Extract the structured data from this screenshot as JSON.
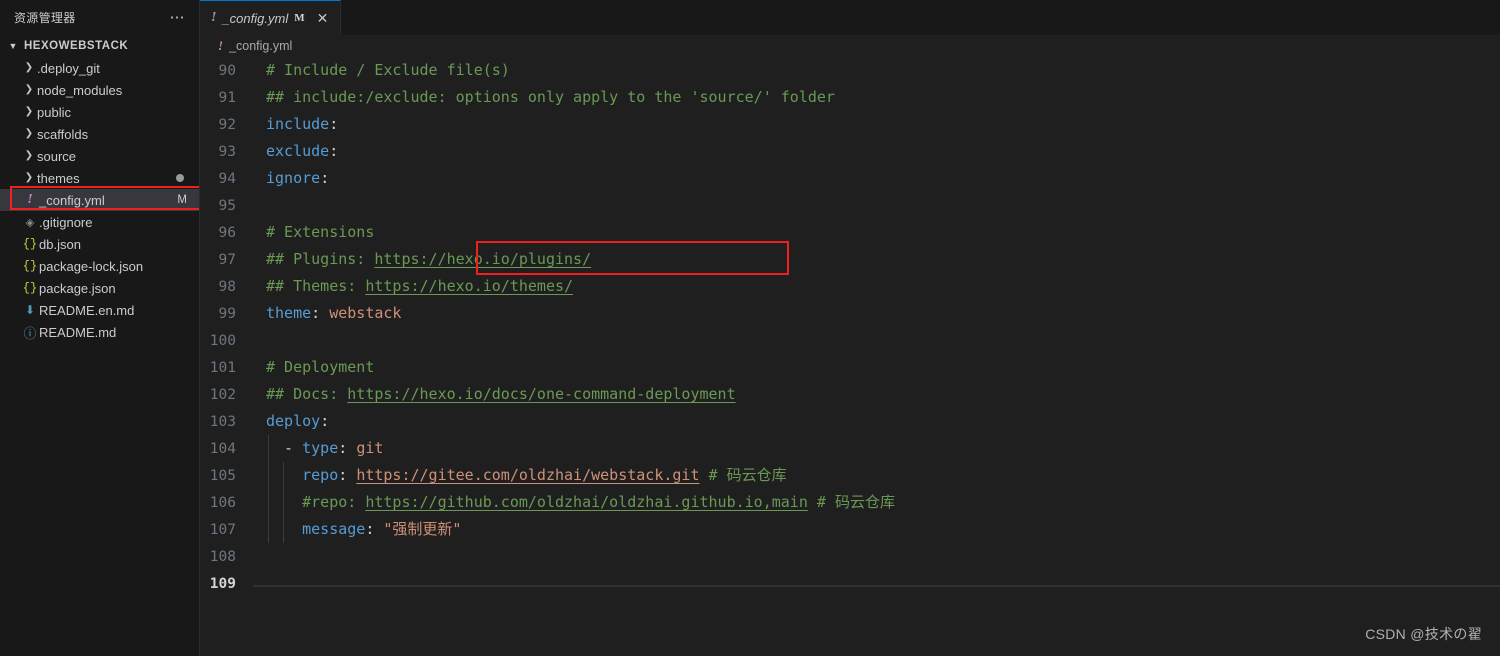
{
  "sidebar": {
    "title": "资源管理器",
    "more_label": "⋯",
    "root": {
      "label": "HEXOWEBSTACK",
      "chevron": "chevron-down"
    },
    "items": [
      {
        "label": ".deploy_git",
        "type": "folder",
        "icon": "chevron-right-icon",
        "badge": ""
      },
      {
        "label": "node_modules",
        "type": "folder",
        "icon": "chevron-right-icon",
        "badge": ""
      },
      {
        "label": "public",
        "type": "folder",
        "icon": "chevron-right-icon",
        "badge": ""
      },
      {
        "label": "scaffolds",
        "type": "folder",
        "icon": "chevron-right-icon",
        "badge": ""
      },
      {
        "label": "source",
        "type": "folder",
        "icon": "chevron-right-icon",
        "badge": ""
      },
      {
        "label": "themes",
        "type": "folder",
        "icon": "chevron-right-icon",
        "badge": "dot"
      },
      {
        "label": "_config.yml",
        "type": "file",
        "icon": "yml-icon",
        "badge": "M",
        "selected": true,
        "annotated": true
      },
      {
        "label": ".gitignore",
        "type": "file",
        "icon": "git-icon",
        "badge": ""
      },
      {
        "label": "db.json",
        "type": "file",
        "icon": "json-icon",
        "badge": ""
      },
      {
        "label": "package-lock.json",
        "type": "file",
        "icon": "json-icon",
        "badge": ""
      },
      {
        "label": "package.json",
        "type": "file",
        "icon": "json-icon",
        "badge": ""
      },
      {
        "label": "README.en.md",
        "type": "file",
        "icon": "markdown-download-icon",
        "badge": ""
      },
      {
        "label": "README.md",
        "type": "file",
        "icon": "markdown-info-icon",
        "badge": ""
      }
    ]
  },
  "tab": {
    "icon": "yml-icon",
    "name": "_config.yml",
    "modified_badge": "M",
    "close": "✕"
  },
  "breadcrumb": {
    "icon": "yml-icon",
    "label": "_config.yml"
  },
  "editor": {
    "first_line": 90,
    "current_line": 109,
    "lines": [
      {
        "n": 90,
        "tokens": [
          {
            "t": "# Include / Exclude file(s)",
            "c": "cm"
          }
        ]
      },
      {
        "n": 91,
        "tokens": [
          {
            "t": "## include:/exclude: options only apply to the 'source/' folder",
            "c": "cm"
          }
        ]
      },
      {
        "n": 92,
        "tokens": [
          {
            "t": "include",
            "c": "key"
          },
          {
            "t": ":",
            "c": "pun"
          }
        ]
      },
      {
        "n": 93,
        "tokens": [
          {
            "t": "exclude",
            "c": "key"
          },
          {
            "t": ":",
            "c": "pun"
          }
        ]
      },
      {
        "n": 94,
        "tokens": [
          {
            "t": "ignore",
            "c": "key"
          },
          {
            "t": ":",
            "c": "pun"
          }
        ]
      },
      {
        "n": 95,
        "tokens": []
      },
      {
        "n": 96,
        "tokens": [
          {
            "t": "# Extensions",
            "c": "cm"
          }
        ]
      },
      {
        "n": 97,
        "tokens": [
          {
            "t": "## Plugins: ",
            "c": "cm"
          },
          {
            "t": "https://hexo.io/plugins/",
            "c": "lnk-green"
          }
        ]
      },
      {
        "n": 98,
        "tokens": [
          {
            "t": "## Themes: ",
            "c": "cm"
          },
          {
            "t": "https://hexo.io/themes/",
            "c": "lnk-green"
          }
        ]
      },
      {
        "n": 99,
        "tokens": [
          {
            "t": "theme",
            "c": "key"
          },
          {
            "t": ": ",
            "c": "pun"
          },
          {
            "t": "webstack",
            "c": "str"
          }
        ],
        "annotated": true
      },
      {
        "n": 100,
        "tokens": []
      },
      {
        "n": 101,
        "tokens": [
          {
            "t": "# Deployment",
            "c": "cm"
          }
        ]
      },
      {
        "n": 102,
        "tokens": [
          {
            "t": "## Docs: ",
            "c": "cm"
          },
          {
            "t": "https://hexo.io/docs/one-command-deployment",
            "c": "lnk-green"
          }
        ]
      },
      {
        "n": 103,
        "tokens": [
          {
            "t": "deploy",
            "c": "key"
          },
          {
            "t": ":",
            "c": "pun"
          }
        ]
      },
      {
        "n": 104,
        "tokens": [
          {
            "t": "  - ",
            "c": "dash"
          },
          {
            "t": "type",
            "c": "key"
          },
          {
            "t": ": ",
            "c": "pun"
          },
          {
            "t": "git",
            "c": "str"
          }
        ],
        "guides": 1
      },
      {
        "n": 105,
        "tokens": [
          {
            "t": "    ",
            "c": "pun"
          },
          {
            "t": "repo",
            "c": "key"
          },
          {
            "t": ": ",
            "c": "pun"
          },
          {
            "t": "https://gitee.com/oldzhai/webstack.git",
            "c": "lnk-orange"
          },
          {
            "t": " # 码云仓库",
            "c": "cm"
          }
        ],
        "guides": 2
      },
      {
        "n": 106,
        "tokens": [
          {
            "t": "    ",
            "c": "pun"
          },
          {
            "t": "#repo: ",
            "c": "cm"
          },
          {
            "t": "https://github.com/oldzhai/oldzhai.github.io,main",
            "c": "lnk-green"
          },
          {
            "t": " # 码云仓库",
            "c": "cm"
          }
        ],
        "guides": 2
      },
      {
        "n": 107,
        "tokens": [
          {
            "t": "    ",
            "c": "pun"
          },
          {
            "t": "message",
            "c": "key"
          },
          {
            "t": ": ",
            "c": "pun"
          },
          {
            "t": "\"强制更新\"",
            "c": "str"
          }
        ],
        "guides": 2
      },
      {
        "n": 108,
        "tokens": []
      },
      {
        "n": 109,
        "tokens": [],
        "current": true
      }
    ]
  },
  "watermark": {
    "text": "CSDN @技术の翟"
  },
  "colors": {
    "sidebar_bg": "#181818",
    "editor_bg": "#1f1f1f",
    "selection_bg": "#37373d",
    "comment": "#6a9955",
    "key": "#569cd6",
    "string": "#ce9178",
    "line_number": "#6e7681",
    "accent": "#0078d4",
    "annotation_red": "#f02020"
  }
}
